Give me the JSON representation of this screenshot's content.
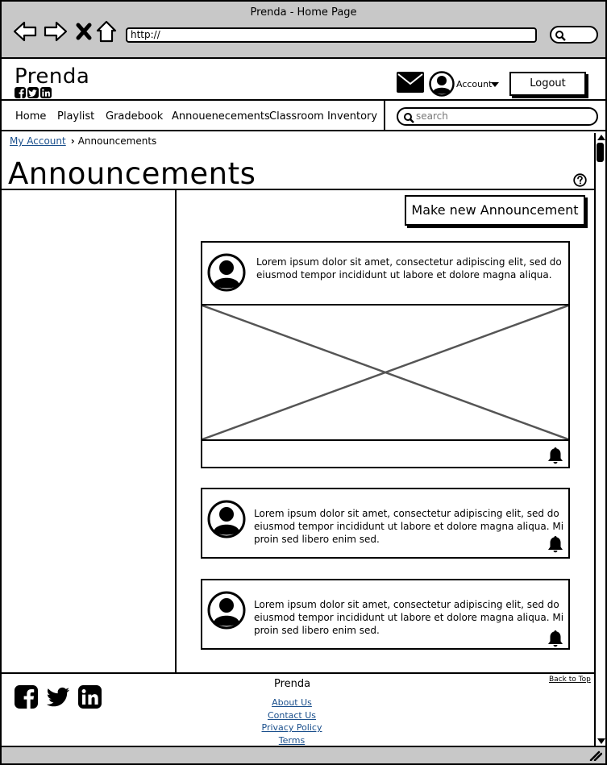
{
  "window": {
    "title": "Prenda - Home Page",
    "url": "http://"
  },
  "header": {
    "brand": "Prenda",
    "social": [
      "facebook-icon",
      "twitter-icon",
      "linkedin-icon"
    ],
    "account_label": "Account",
    "logout_label": "Logout"
  },
  "nav": {
    "items": [
      {
        "label": "Home"
      },
      {
        "label": "Playlist"
      },
      {
        "label": "Gradebook"
      },
      {
        "label": "Annouenecements"
      },
      {
        "label": "Classroom Inventory"
      }
    ],
    "search_placeholder": "search"
  },
  "breadcrumb": {
    "parent": "My Account",
    "current": "Announcements"
  },
  "page": {
    "title": "Announcements",
    "make_button": "Make new Announcement"
  },
  "announcements": [
    {
      "text": "Lorem ipsum dolor sit amet, consectetur adipiscing elit, sed do eiusmod tempor incididunt ut labore et dolore magna aliqua.",
      "has_image": true
    },
    {
      "text": "Lorem ipsum dolor sit amet, consectetur adipiscing elit, sed do eiusmod tempor incididunt ut labore et dolore magna aliqua. Mi proin sed libero enim sed.",
      "has_image": false
    },
    {
      "text": "Lorem ipsum dolor sit amet, consectetur adipiscing elit, sed do eiusmod tempor incididunt ut labore et dolore magna aliqua. Mi proin sed libero enim sed.",
      "has_image": false
    }
  ],
  "footer": {
    "brand": "Prenda",
    "back_to_top": "Back to Top",
    "links": [
      "About Us",
      "Contact Us",
      "Privacy Policy",
      "Terms"
    ]
  }
}
